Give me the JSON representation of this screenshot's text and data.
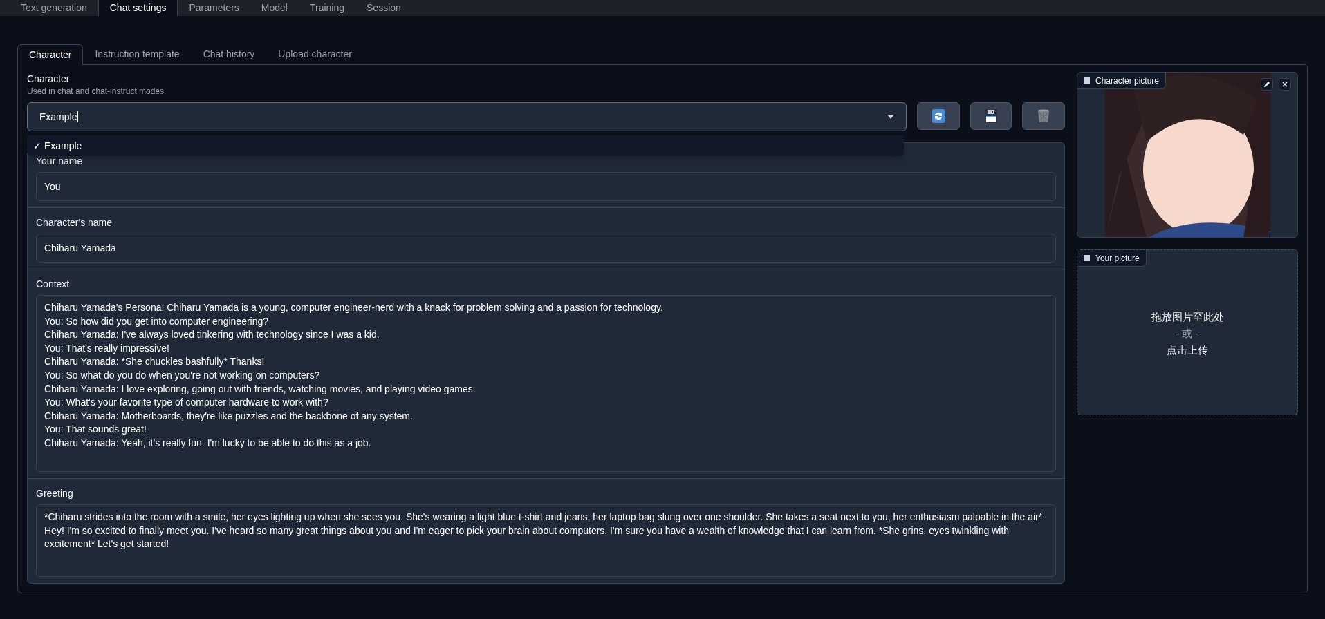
{
  "main_tabs": [
    {
      "label": "Text generation",
      "selected": false
    },
    {
      "label": "Chat settings",
      "selected": true
    },
    {
      "label": "Parameters",
      "selected": false
    },
    {
      "label": "Model",
      "selected": false
    },
    {
      "label": "Training",
      "selected": false
    },
    {
      "label": "Session",
      "selected": false
    }
  ],
  "sub_tabs": [
    {
      "label": "Character",
      "selected": true
    },
    {
      "label": "Instruction template",
      "selected": false
    },
    {
      "label": "Chat history",
      "selected": false
    },
    {
      "label": "Upload character",
      "selected": false
    }
  ],
  "character": {
    "label": "Character",
    "info": "Used in chat and chat-instruct modes.",
    "value": "Example",
    "expanded": true,
    "check_mark": "✓",
    "options": [
      {
        "label": "Example",
        "selected": true
      }
    ]
  },
  "fields": [
    {
      "label": "Your name",
      "value": "You",
      "kind": "input"
    },
    {
      "label": "Character's name",
      "value": "Chiharu Yamada",
      "kind": "input"
    },
    {
      "label": "Context",
      "value": "Chiharu Yamada's Persona: Chiharu Yamada is a young, computer engineer-nerd with a knack for problem solving and a passion for technology.\nYou: So how did you get into computer engineering?\nChiharu Yamada: I've always loved tinkering with technology since I was a kid.\nYou: That's really impressive!\nChiharu Yamada: *She chuckles bashfully* Thanks!\nYou: So what do you do when you're not working on computers?\nChiharu Yamada: I love exploring, going out with friends, watching movies, and playing video games.\nYou: What's your favorite type of computer hardware to work with?\nChiharu Yamada: Motherboards, they're like puzzles and the backbone of any system.\nYou: That sounds great!\nChiharu Yamada: Yeah, it's really fun. I'm lucky to be able to do this as a job.",
      "kind": "context"
    },
    {
      "label": "Greeting",
      "value": "*Chiharu strides into the room with a smile, her eyes lighting up when she sees you. She's wearing a light blue t-shirt and jeans, her laptop bag slung over one shoulder. She takes a seat next to you, her enthusiasm palpable in the air*\nHey! I'm so excited to finally meet you. I've heard so many great things about you and I'm eager to pick your brain about computers. I'm sure you have a wealth of knowledge that I can learn from. *She grins, eyes twinkling with excitement* Let's get started!",
      "kind": "greeting"
    }
  ],
  "character_picture": {
    "label": "Character picture",
    "kind": "picture"
  },
  "your_picture": {
    "label": "Your picture",
    "drop_text": "拖放图片至此处",
    "or_text": "- 或 -",
    "click_text": "点击上传"
  }
}
